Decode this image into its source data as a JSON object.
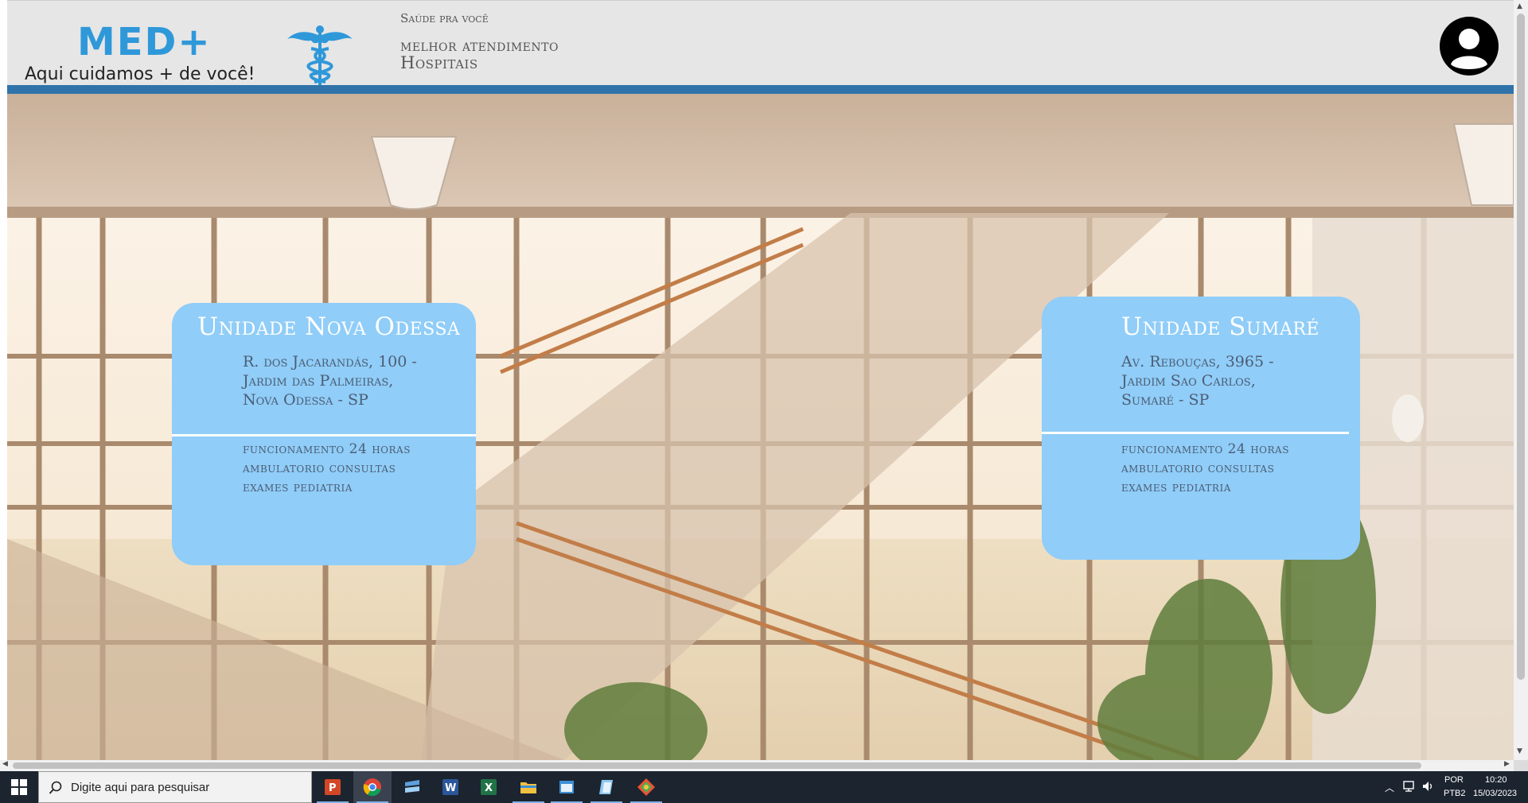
{
  "header": {
    "logo_text": "MED+",
    "tagline": "Aqui cuidamos + de você!",
    "slogan_small": "Saúde pra você",
    "slogan_line1": "melhor atendimento",
    "slogan_line2": "Hospitais"
  },
  "cards": [
    {
      "title": "Unidade Nova Odessa",
      "address": [
        "R. dos Jacarandás, 100 -",
        "Jardim das Palmeiras,",
        "Nova Odessa - SP"
      ],
      "features": [
        "funcionamento 24 horas",
        "ambulatorio consultas",
        "exames pediatria"
      ]
    },
    {
      "title": "Unidade Sumaré",
      "address": [
        "Av. Rebouças, 3965 -",
        "Jardim Sao Carlos,",
        "Sumaré - SP"
      ],
      "features": [
        "funcionamento 24 horas",
        "ambulatorio consultas",
        "exames pediatria"
      ]
    }
  ],
  "taskbar": {
    "search_placeholder": "Digite aqui para pesquisar",
    "apps": [
      "powerpoint-icon",
      "chrome-icon",
      "azure-data-studio-icon",
      "word-icon",
      "excel-icon",
      "file-explorer-icon",
      "window-icon",
      "notepad-icon",
      "git-icon"
    ],
    "lang_line1": "POR",
    "lang_line2": "PTB2",
    "time": "10:20",
    "date": "15/03/2023"
  },
  "colors": {
    "accent": "#2f98d9",
    "header_bar": "#2f73aa",
    "card_bg": "#90cdf8",
    "caduceus": "#2f98d9"
  }
}
